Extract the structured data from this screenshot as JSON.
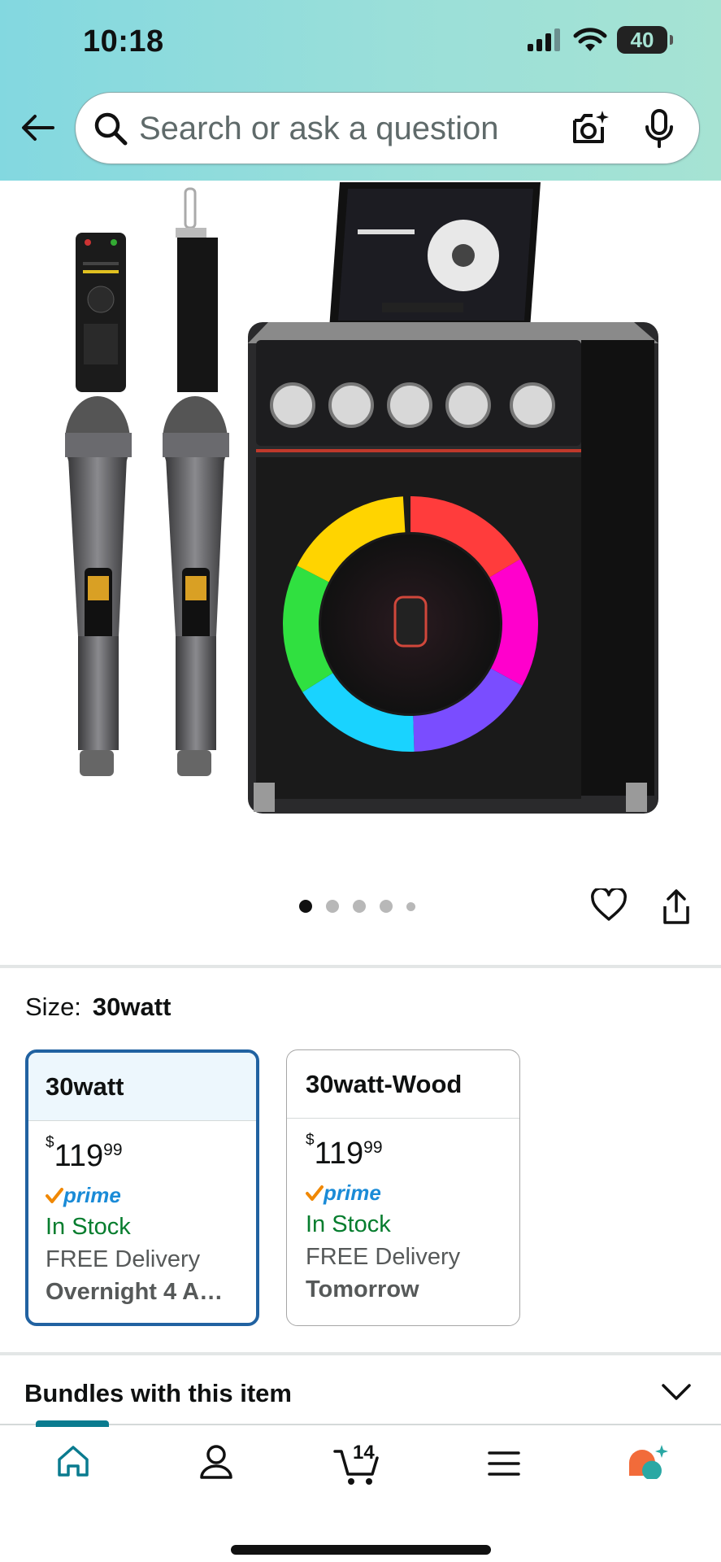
{
  "status_bar": {
    "time": "10:18",
    "battery": "40"
  },
  "search": {
    "placeholder": "Search or ask a question"
  },
  "carousel": {
    "total_dots": 5,
    "active_index": 0
  },
  "size": {
    "label": "Size:",
    "selected": "30watt"
  },
  "options": [
    {
      "name": "30watt",
      "price_symbol": "$",
      "price_whole": "119",
      "price_cents": "99",
      "prime": "prime",
      "stock": "In Stock",
      "delivery": "FREE Delivery",
      "delivery_when": "Overnight 4 A…",
      "selected": true
    },
    {
      "name": "30watt-Wood",
      "price_symbol": "$",
      "price_whole": "119",
      "price_cents": "99",
      "prime": "prime",
      "stock": "In Stock",
      "delivery": "FREE Delivery",
      "delivery_when": "Tomorrow",
      "selected": false
    }
  ],
  "bundles": {
    "title": "Bundles with this item"
  },
  "bottom_nav": {
    "cart_count": "14",
    "items": [
      "home-icon",
      "account-icon",
      "cart-icon",
      "menu-icon",
      "rufus-icon"
    ]
  },
  "colors": {
    "accent": "#2162a1",
    "in_stock": "#067d2e",
    "prime_blue": "#1a8bd7",
    "nav_active": "#0a7b8f"
  }
}
